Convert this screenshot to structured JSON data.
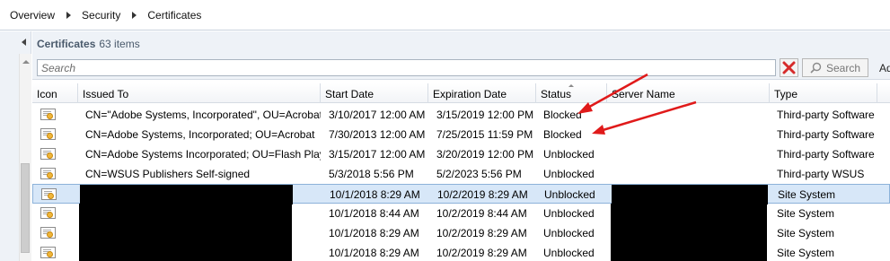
{
  "breadcrumb": [
    "Overview",
    "Security",
    "Certificates"
  ],
  "pane": {
    "title": "Certificates",
    "count": "63 items"
  },
  "search": {
    "placeholder": "Search",
    "button_label": "Search",
    "add_label": "Ad"
  },
  "columns": [
    "Icon",
    "Issued To",
    "Start Date",
    "Expiration Date",
    "Status",
    "Server Name",
    "Type"
  ],
  "rows": [
    {
      "issued_to": "CN=\"Adobe Systems, Incorporated\", OU=Acrobat",
      "start_date": "3/10/2017 12:00 AM",
      "expiration_date": "3/15/2019 12:00 PM",
      "status": "Blocked",
      "server_name": "",
      "type": "Third-party Software",
      "redacted": false,
      "selected": false,
      "icon": "certificate-icon"
    },
    {
      "issued_to": "CN=Adobe Systems, Incorporated; OU=Acrobat",
      "start_date": "7/30/2013 12:00 AM",
      "expiration_date": "7/25/2015 11:59 PM",
      "status": "Blocked",
      "server_name": "",
      "type": "Third-party Software",
      "redacted": false,
      "selected": false,
      "icon": "certificate-icon"
    },
    {
      "issued_to": "CN=Adobe Systems Incorporated; OU=Flash Player",
      "start_date": "3/15/2017 12:00 AM",
      "expiration_date": "3/20/2019 12:00 PM",
      "status": "Unblocked",
      "server_name": "",
      "type": "Third-party Software",
      "redacted": false,
      "selected": false,
      "icon": "certificate-icon"
    },
    {
      "issued_to": "CN=WSUS Publishers Self-signed",
      "start_date": "5/3/2018 5:56 PM",
      "expiration_date": "5/2/2023 5:56 PM",
      "status": "Unblocked",
      "server_name": "",
      "type": "Third-party WSUS",
      "redacted": false,
      "selected": false,
      "icon": "certificate-icon"
    },
    {
      "issued_to": "",
      "start_date": "10/1/2018 8:29 AM",
      "expiration_date": "10/2/2019 8:29 AM",
      "status": "Unblocked",
      "server_name": "",
      "type": "Site System",
      "redacted": true,
      "selected": true,
      "icon": "certificate-icon"
    },
    {
      "issued_to": "",
      "start_date": "10/1/2018 8:44 AM",
      "expiration_date": "10/2/2019 8:44 AM",
      "status": "Unblocked",
      "server_name": "",
      "type": "Site System",
      "redacted": true,
      "selected": false,
      "icon": "certificate-icon"
    },
    {
      "issued_to": "",
      "start_date": "10/1/2018 8:29 AM",
      "expiration_date": "10/2/2019 8:29 AM",
      "status": "Unblocked",
      "server_name": "",
      "type": "Site System",
      "redacted": true,
      "selected": false,
      "icon": "certificate-icon"
    },
    {
      "issued_to": "",
      "start_date": "10/1/2018 8:29 AM",
      "expiration_date": "10/2/2019 8:29 AM",
      "status": "Unblocked",
      "server_name": "",
      "type": "Site System",
      "redacted": true,
      "selected": false,
      "icon": "certificate-icon"
    }
  ],
  "colors": {
    "selected_row": "#d7e7f8",
    "annotation_arrow": "#e01a1a",
    "header_text": "#4a5a6c"
  }
}
